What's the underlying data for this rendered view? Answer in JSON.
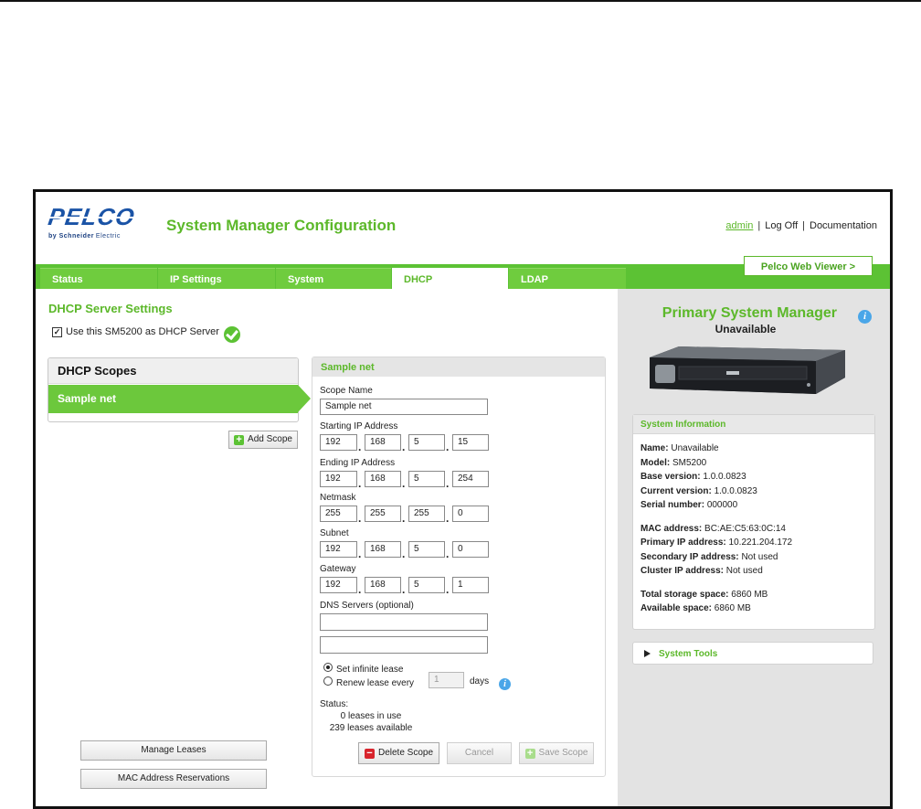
{
  "header": {
    "logo_text": "PELCO",
    "logo_sub_bold": "by Schneider",
    "logo_sub_rest": "Electric",
    "title": "System Manager Configuration",
    "user_link": "admin",
    "logoff": "Log Off",
    "documentation": "Documentation",
    "web_viewer": "Pelco Web Viewer >"
  },
  "tabs": [
    {
      "label": "Status"
    },
    {
      "label": "IP Settings"
    },
    {
      "label": "System"
    },
    {
      "label": "DHCP",
      "active": true
    },
    {
      "label": "LDAP"
    }
  ],
  "dhcp": {
    "section_title": "DHCP Server Settings",
    "use_server_label": "Use this SM5200 as DHCP Server",
    "use_server_checked": true,
    "scopes_header": "DHCP Scopes",
    "scopes": [
      "Sample net"
    ],
    "add_scope": "Add Scope",
    "manage_leases": "Manage Leases",
    "mac_reservations": "MAC Address Reservations"
  },
  "scope": {
    "header": "Sample net",
    "name_label": "Scope Name",
    "name_value": "Sample net",
    "start_label": "Starting IP Address",
    "start": [
      "192",
      "168",
      "5",
      "15"
    ],
    "end_label": "Ending IP Address",
    "end": [
      "192",
      "168",
      "5",
      "254"
    ],
    "netmask_label": "Netmask",
    "netmask": [
      "255",
      "255",
      "255",
      "0"
    ],
    "subnet_label": "Subnet",
    "subnet": [
      "192",
      "168",
      "5",
      "0"
    ],
    "gateway_label": "Gateway",
    "gateway": [
      "192",
      "168",
      "5",
      "1"
    ],
    "dns_label": "DNS Servers (optional)",
    "dns": [
      "",
      ""
    ],
    "infinite_lease": "Set infinite lease",
    "renew_lease": "Renew lease every",
    "renew_days_value": "1",
    "days_label": "days",
    "status_label": "Status:",
    "status_in_use": "0 leases in use",
    "status_available": "239 leases available",
    "delete_scope": "Delete Scope",
    "cancel": "Cancel",
    "save_scope": "Save Scope"
  },
  "primary": {
    "title": "Primary System Manager",
    "status": "Unavailable"
  },
  "system_info": {
    "header": "System Information",
    "rows_1": [
      {
        "k": "Name:",
        "v": "Unavailable"
      },
      {
        "k": "Model:",
        "v": "SM5200"
      },
      {
        "k": "Base version:",
        "v": "1.0.0.0823"
      },
      {
        "k": "Current version:",
        "v": "1.0.0.0823"
      },
      {
        "k": "Serial number:",
        "v": "000000"
      }
    ],
    "rows_2": [
      {
        "k": "MAC address:",
        "v": "BC:AE:C5:63:0C:14"
      },
      {
        "k": "Primary IP address:",
        "v": "10.221.204.172"
      },
      {
        "k": "Secondary IP address:",
        "v": "Not used"
      },
      {
        "k": "Cluster IP address:",
        "v": "Not used"
      }
    ],
    "rows_3": [
      {
        "k": "Total storage space:",
        "v": "6860 MB"
      },
      {
        "k": "Available space:",
        "v": "6860 MB"
      }
    ]
  },
  "system_tools": "System Tools",
  "colors": {
    "brand_green": "#5cb82a",
    "pelco_blue": "#1a53a6",
    "info_blue": "#4aa6e8",
    "delete_red": "#d8242c"
  }
}
